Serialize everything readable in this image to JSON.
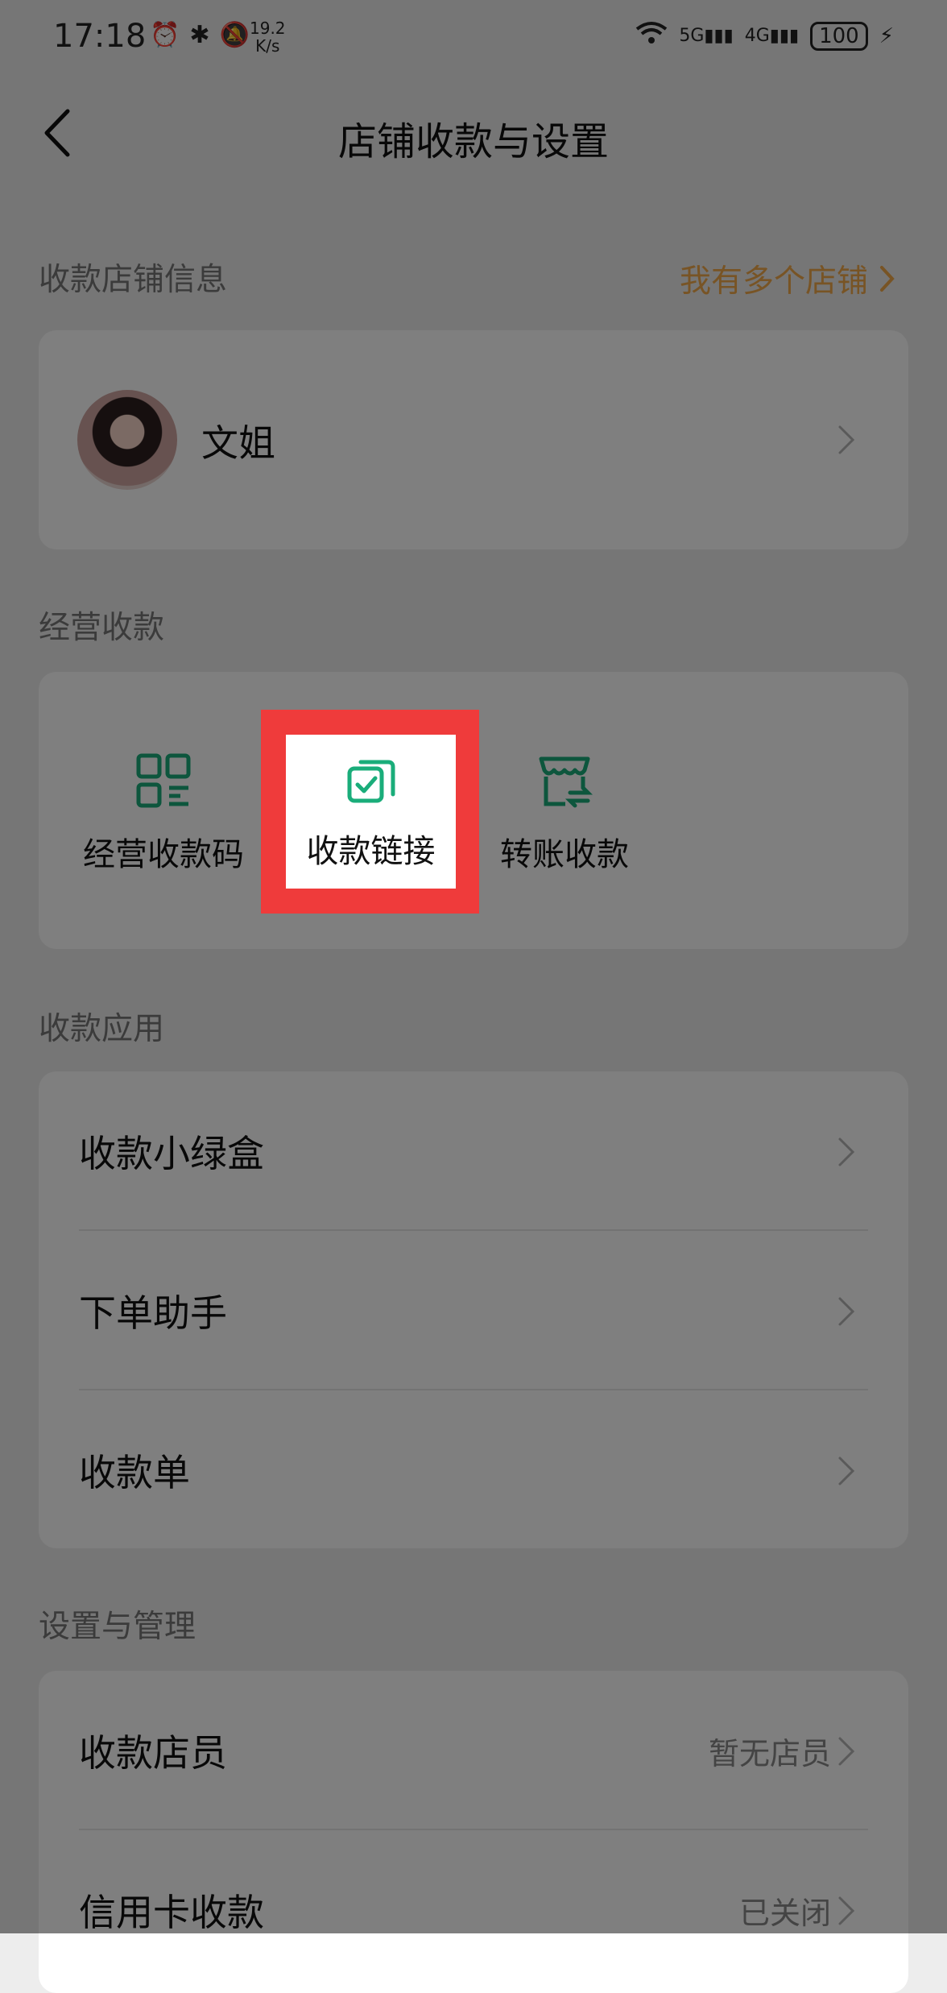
{
  "status": {
    "time": "17:18",
    "net_speed_value": "19.2",
    "net_speed_unit": "K/s",
    "sig1": "5G",
    "sig2": "4G",
    "battery": "100"
  },
  "nav": {
    "title": "店铺收款与设置"
  },
  "store_section": {
    "label": "收款店铺信息",
    "multi_store_link": "我有多个店铺",
    "store_name": "文姐"
  },
  "business_section": {
    "label": "经营收款",
    "items": [
      {
        "label": "经营收款码",
        "icon": "qr-code-icon"
      },
      {
        "label": "收款链接",
        "icon": "payment-link-icon"
      },
      {
        "label": "转账收款",
        "icon": "transfer-store-icon"
      }
    ]
  },
  "apps_section": {
    "label": "收款应用",
    "rows": [
      {
        "label": "收款小绿盒"
      },
      {
        "label": "下单助手"
      },
      {
        "label": "收款单"
      }
    ]
  },
  "settings_section": {
    "label": "设置与管理",
    "rows": [
      {
        "label": "收款店员",
        "value": "暂无店员"
      },
      {
        "label": "信用卡收款",
        "value": "已关闭"
      }
    ]
  },
  "colors": {
    "accent_green": "#1aad7a",
    "link_orange": "#f0a94b",
    "highlight_red": "#ef3b3b"
  }
}
